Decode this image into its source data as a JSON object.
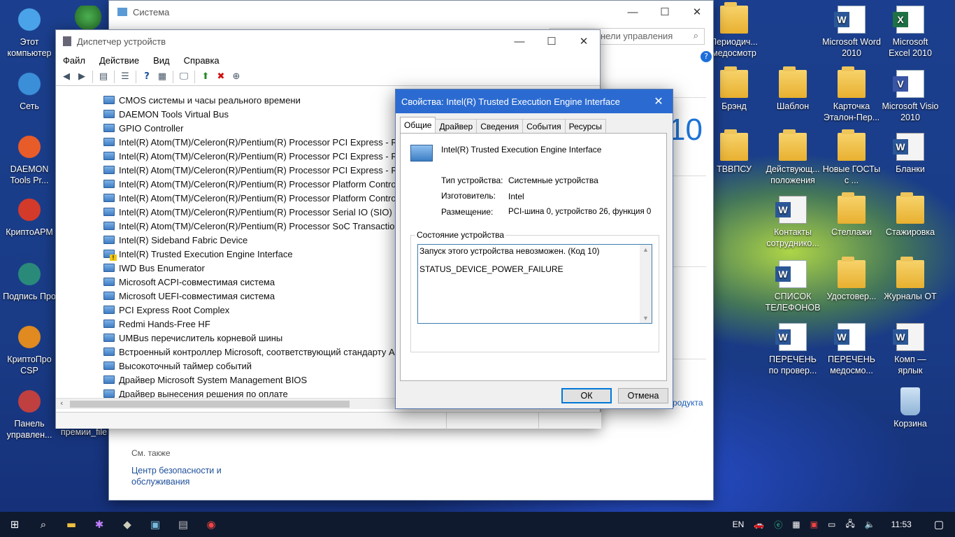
{
  "desktop_left": [
    {
      "name": "desk-icon-this-pc",
      "label": "Этот компьютер",
      "icon": "computer-icon"
    },
    {
      "name": "desk-icon-network",
      "label": "Сеть",
      "icon": "network-icon"
    },
    {
      "name": "desk-icon-daemon",
      "label": "DAEMON Tools Pr...",
      "icon": "daemon-icon"
    },
    {
      "name": "desk-icon-cryptoarm",
      "label": "КриптоАРМ",
      "icon": "cryptoarm-icon"
    },
    {
      "name": "desk-icon-sign",
      "label": "Подпись Про",
      "icon": "sign-icon"
    },
    {
      "name": "desk-icon-cryptopro",
      "label": "КриптоПро CSP",
      "icon": "cryptopro-icon"
    },
    {
      "name": "desk-icon-control-panel",
      "label": "Панель управлен...",
      "icon": "control-panel-icon"
    }
  ],
  "desktop_col2": {
    "top_label": "",
    "bottom_label": "премии_file"
  },
  "desktop_right": [
    {
      "label": "Периодич... медосмотр",
      "kind": "folder"
    },
    {
      "label": "Microsoft Word 2010",
      "kind": "word"
    },
    {
      "label": "Microsoft Excel 2010",
      "kind": "excel"
    },
    {
      "label": "Брэнд",
      "kind": "folder"
    },
    {
      "label": "Шаблон",
      "kind": "folder"
    },
    {
      "label": "Карточка Эталон-Пер...",
      "kind": "folder"
    },
    {
      "label": "Microsoft Visio 2010",
      "kind": "visio"
    },
    {
      "label": "ТВВПСУ",
      "kind": "folder"
    },
    {
      "label": "Действующ... положения",
      "kind": "folder"
    },
    {
      "label": "Новые ГОСТы с ...",
      "kind": "folder"
    },
    {
      "label": "Бланки",
      "kind": "pages"
    },
    {
      "label": "Контакты сотруднико...",
      "kind": "doc"
    },
    {
      "label": "Стеллажи",
      "kind": "folder"
    },
    {
      "label": "Стажировка",
      "kind": "folder"
    },
    {
      "label": "СПИСОК ТЕЛЕФОНОВ",
      "kind": "word"
    },
    {
      "label": "Удостовер...",
      "kind": "folder"
    },
    {
      "label": "Журналы ОТ",
      "kind": "folder"
    },
    {
      "label": "ПЕРЕЧЕНЬ по провер...",
      "kind": "word"
    },
    {
      "label": "ПЕРЕЧЕНЬ медосмо...",
      "kind": "word"
    },
    {
      "label": "Комп — ярлык",
      "kind": "doc"
    },
    {
      "label": "Корзина",
      "kind": "recycle"
    }
  ],
  "system_window": {
    "title": "Система",
    "search_placeholder": "нели управления",
    "win10_text": "10",
    "product_link": "родукта",
    "see_also": "См. также",
    "security_link": "Центр безопасности и обслуживания"
  },
  "devmgr": {
    "title": "Диспетчер устройств",
    "menu": [
      "Файл",
      "Действие",
      "Вид",
      "Справка"
    ],
    "devices": [
      {
        "label": "CMOS системы и часы реального времени",
        "warn": false
      },
      {
        "label": "DAEMON Tools Virtual Bus",
        "warn": false
      },
      {
        "label": "GPIO Controller",
        "warn": false
      },
      {
        "label": "Intel(R) Atom(TM)/Celeron(R)/Pentium(R) Processor PCI Express - Ro",
        "warn": false
      },
      {
        "label": "Intel(R) Atom(TM)/Celeron(R)/Pentium(R) Processor PCI Express - Ro",
        "warn": false
      },
      {
        "label": "Intel(R) Atom(TM)/Celeron(R)/Pentium(R) Processor PCI Express - Ro",
        "warn": false
      },
      {
        "label": "Intel(R) Atom(TM)/Celeron(R)/Pentium(R) Processor Platform Contro",
        "warn": false
      },
      {
        "label": "Intel(R) Atom(TM)/Celeron(R)/Pentium(R) Processor Platform Contro",
        "warn": false
      },
      {
        "label": "Intel(R) Atom(TM)/Celeron(R)/Pentium(R) Processor Serial IO (SIO) -",
        "warn": false
      },
      {
        "label": "Intel(R) Atom(TM)/Celeron(R)/Pentium(R) Processor SoC Transaction",
        "warn": false
      },
      {
        "label": "Intel(R) Sideband Fabric Device",
        "warn": false
      },
      {
        "label": "Intel(R) Trusted Execution Engine Interface",
        "warn": true
      },
      {
        "label": "IWD Bus Enumerator",
        "warn": false
      },
      {
        "label": "Microsoft ACPI-совместимая система",
        "warn": false
      },
      {
        "label": "Microsoft UEFI-совместимая система",
        "warn": false
      },
      {
        "label": "PCI Express Root Complex",
        "warn": false
      },
      {
        "label": "Redmi Hands-Free HF",
        "warn": false
      },
      {
        "label": "UMBus перечислитель корневой шины",
        "warn": false
      },
      {
        "label": "Встроенный контроллер Microsoft, соответствующий стандарту A",
        "warn": false
      },
      {
        "label": "Высокоточный таймер событий",
        "warn": false
      },
      {
        "label": "Драйвер Microsoft System Management BIOS",
        "warn": false
      },
      {
        "label": "Драйвер вынесения решения по оплате",
        "warn": false
      }
    ]
  },
  "props": {
    "title": "Свойства: Intel(R) Trusted Execution Engine Interface",
    "tabs": [
      "Общие",
      "Драйвер",
      "Сведения",
      "События",
      "Ресурсы"
    ],
    "device_name": "Intel(R) Trusted Execution Engine Interface",
    "type_label": "Тип устройства:",
    "type_value": "Системные устройства",
    "mfr_label": "Изготовитель:",
    "mfr_value": "Intel",
    "loc_label": "Размещение:",
    "loc_value": "PCI-шина 0, устройство 26, функция 0",
    "status_group": "Состояние устройства",
    "status_line1": "Запуск этого устройства невозможен. (Код 10)",
    "status_line2": "STATUS_DEVICE_POWER_FAILURE",
    "ok": "ОК",
    "cancel": "Отмена"
  },
  "taskbar": {
    "lang": "EN",
    "time": "11:53"
  }
}
